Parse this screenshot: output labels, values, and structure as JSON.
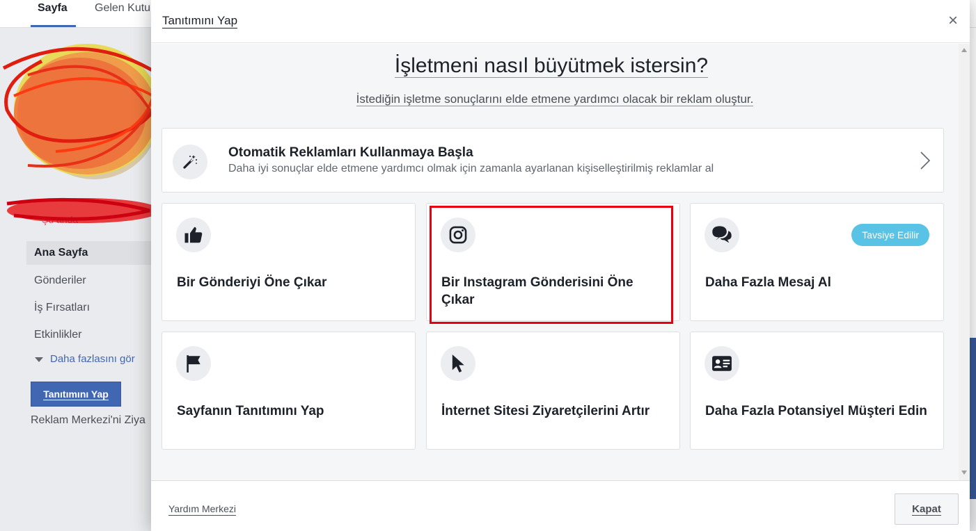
{
  "background": {
    "tabs": [
      {
        "label": "Sayfa",
        "active": true
      },
      {
        "label": "Gelen Kutu",
        "active": false
      }
    ],
    "nav_obscured_label": "Şu anda",
    "nav": [
      {
        "label": "Ana Sayfa",
        "active": true
      },
      {
        "label": "Gönderiler",
        "active": false
      },
      {
        "label": "İş Fırsatları",
        "active": false
      },
      {
        "label": "Etkinlikler",
        "active": false
      }
    ],
    "more_label": "Daha fazlasını gör",
    "promote_button": "Tanıtımını Yap",
    "ads_center_text": "Reklam Merkezi'ni Ziya"
  },
  "dialog": {
    "title": "Tanıtımını Yap",
    "close_icon": "close-icon",
    "headline": "İşletmeni nasıl büyütmek istersin?",
    "subheadline": "İstediğin işletme sonuçlarını elde etmene yardımcı olacak bir reklam oluştur.",
    "auto_ads": {
      "title": "Otomatik Reklamları Kullanmaya Başla",
      "description": "Daha iyi sonuçlar elde etmene yardımcı olmak için zamanla ayarlanan kişiselleştirilmiş reklamlar al",
      "icon": "magic-wand-icon"
    },
    "cards": [
      {
        "label": "Bir Gönderiyi Öne Çıkar",
        "icon": "thumbs-up-icon"
      },
      {
        "label": "Bir Instagram Gönderisini Öne Çıkar",
        "icon": "instagram-icon",
        "highlighted": true
      },
      {
        "label": "Daha Fazla Mesaj Al",
        "icon": "chat-bubbles-icon",
        "badge": "Tavsiye Edilir"
      },
      {
        "label": "Sayfanın Tanıtımını Yap",
        "icon": "flag-icon"
      },
      {
        "label": "İnternet Sitesi Ziyaretçilerini Artır",
        "icon": "cursor-icon"
      },
      {
        "label": "Daha Fazla Potansiyel Müşteri Edin",
        "icon": "contact-card-icon"
      }
    ],
    "footer": {
      "help_link": "Yardım Merkezi",
      "close_button": "Kapat"
    }
  },
  "colors": {
    "accent": "#4267b2",
    "highlight_border": "#e8000f",
    "badge": "#59c3e5"
  }
}
